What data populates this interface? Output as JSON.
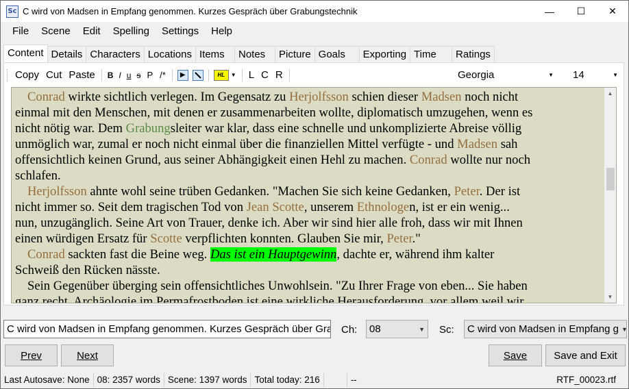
{
  "window": {
    "icon_text": "Sc",
    "title": "C wird von Madsen in Empfang genommen. Kurzes Gespräch über Grabungstechnik",
    "minimize": "—",
    "maximize": "☐",
    "close": "✕"
  },
  "menu": [
    "File",
    "Scene",
    "Edit",
    "Spelling",
    "Settings",
    "Help"
  ],
  "tabs": [
    "Content",
    "Details",
    "Characters",
    "Locations",
    "Items",
    "Notes",
    "Picture",
    "Goals",
    "Exporting",
    "Time",
    "Ratings"
  ],
  "toolbar": {
    "copy": "Copy",
    "cut": "Cut",
    "paste": "Paste",
    "bold": "B",
    "italic": "I",
    "underline": "u",
    "strike": "s",
    "p": "P",
    "comment": "/*",
    "highlight": "HL",
    "left": "L",
    "center": "C",
    "right": "R",
    "font": "Georgia",
    "size": "14"
  },
  "editor": {
    "lines": [
      {
        "indent": true,
        "parts": [
          [
            "n",
            "Conrad"
          ],
          [
            "t",
            " wirkte sichtlich verlegen. Im Gegensatz zu "
          ],
          [
            "n",
            "Herjolfsson"
          ],
          [
            "t",
            " schien dieser "
          ],
          [
            "n",
            "Madsen"
          ],
          [
            "t",
            " noch nicht"
          ]
        ]
      },
      {
        "parts": [
          [
            "t",
            "einmal mit den Menschen, mit denen er zusammenarbeiten wollte, diplomatisch umzugehen, wenn es"
          ]
        ]
      },
      {
        "parts": [
          [
            "t",
            "nicht nötig war. Dem "
          ],
          [
            "g",
            "Grabung"
          ],
          [
            "t",
            "sleiter war klar, dass eine schnelle und unkomplizierte Abreise völlig"
          ]
        ]
      },
      {
        "parts": [
          [
            "t",
            "unmöglich war, zumal er noch nicht einmal über die finanziellen Mittel verfügte - und "
          ],
          [
            "n",
            "Madsen"
          ],
          [
            "t",
            " sah"
          ]
        ]
      },
      {
        "parts": [
          [
            "t",
            "offensichtlich keinen Grund, aus seiner Abhängigkeit einen Hehl zu machen. "
          ],
          [
            "n",
            "Conrad"
          ],
          [
            "t",
            " wollte nur noch"
          ]
        ]
      },
      {
        "parts": [
          [
            "t",
            "schlafen."
          ]
        ]
      },
      {
        "indent": true,
        "parts": [
          [
            "n",
            "Herjolfsson"
          ],
          [
            "t",
            " ahnte wohl seine trüben Gedanken. \"Machen Sie sich keine Gedanken, "
          ],
          [
            "n",
            "Peter"
          ],
          [
            "t",
            ". Der ist"
          ]
        ]
      },
      {
        "parts": [
          [
            "t",
            "nicht immer so. Seit dem tragischen Tod von "
          ],
          [
            "n",
            "Jean Scotte"
          ],
          [
            "t",
            ", unserem "
          ],
          [
            "n",
            "Ethnologe"
          ],
          [
            "t",
            "n, ist er ein wenig..."
          ]
        ]
      },
      {
        "parts": [
          [
            "t",
            "nun, unzugänglich. Seine Art von Trauer, denke ich. Aber wir sind hier alle froh, dass wir mit Ihnen"
          ]
        ]
      },
      {
        "parts": [
          [
            "t",
            "einen würdigen Ersatz für "
          ],
          [
            "n",
            "Scotte"
          ],
          [
            "t",
            " verpflichten konnten. Glauben Sie mir, "
          ],
          [
            "n",
            "Peter"
          ],
          [
            "t",
            ".\""
          ]
        ]
      },
      {
        "indent": true,
        "parts": [
          [
            "n",
            "Conrad"
          ],
          [
            "t",
            " sackten fast die Beine weg. "
          ],
          [
            "h",
            "Das ist ein Hauptgewinn"
          ],
          [
            "t",
            ", dachte er, während ihm kalter"
          ]
        ]
      },
      {
        "parts": [
          [
            "t",
            "Schweiß den Rücken nässte."
          ]
        ]
      },
      {
        "indent": true,
        "parts": [
          [
            "t",
            "Sein Gegenüber überging sein offensichtliches Unwohlsein. \"Zu Ihrer Frage von eben... Sie haben"
          ]
        ]
      },
      {
        "parts": [
          [
            "t",
            "ganz recht. Archäologie im Permafrostboden ist eine wirkliche Herausforderung, vor allem weil wir"
          ]
        ]
      }
    ]
  },
  "scene_title_field": "C wird von Madsen in Empfang genommen. Kurzes Gespräch über Grab",
  "chapter_label": "Ch:",
  "chapter_value": "08",
  "scene_label": "Sc:",
  "scene_value": "C wird von Madsen in Empfang g",
  "buttons": {
    "prev": "Prev",
    "next": "Next",
    "save": "Save",
    "save_exit": "Save and Exit"
  },
  "status": {
    "autosave": "Last Autosave: None",
    "chapter_words": "08: 2357 words",
    "scene_words": "Scene: 1397 words",
    "total_today": "Total today: 216",
    "dash": "--",
    "file": "RTF_00023.rtf"
  }
}
